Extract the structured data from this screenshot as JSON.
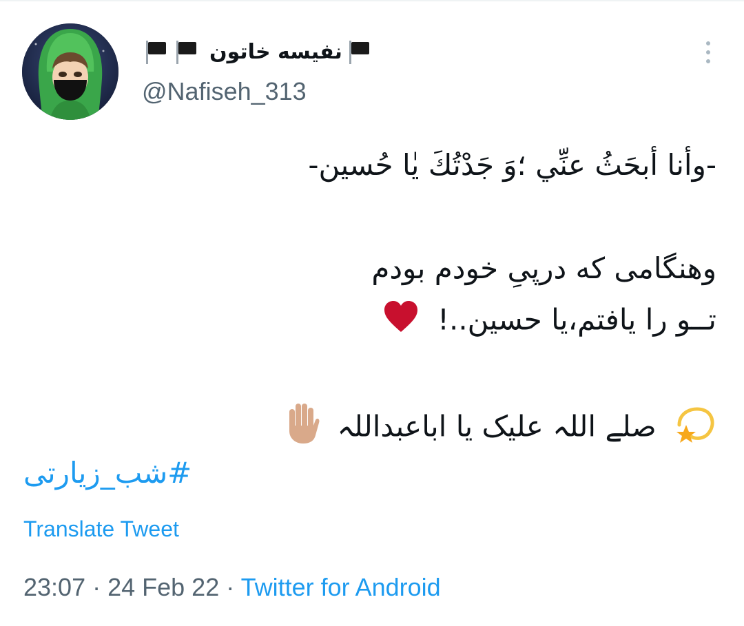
{
  "author": {
    "display_name": "نفیسه خاتون",
    "handle": "@Nafiseh_313",
    "name_emoji": "flag-icons"
  },
  "tweet": {
    "line1": "-وأنا أبحَثُ عنِّي ؛وَ جَدْتُكَ يٰا حُسين-",
    "line2": "وهنگامی که درپیِ خودم بودم",
    "line3": "تــو را یافتم،یا حسین..!",
    "line4": "صلے اللہ علیک یا اباعبداللہ",
    "hashtag": "#شب_زیارتی",
    "line3_emoji": "heart-icon",
    "line4_emoji_start": "dizzy-star-icon",
    "line4_emoji_end": "raised-hand-icon"
  },
  "actions": {
    "translate_label": "Translate Tweet"
  },
  "meta": {
    "time": "23:07",
    "separator1": " · ",
    "date": "24 Feb 22",
    "separator2": " · ",
    "source": "Twitter for Android"
  },
  "colors": {
    "link": "#1d9bf0",
    "secondary_text": "#536471",
    "heart": "#c8102e"
  }
}
